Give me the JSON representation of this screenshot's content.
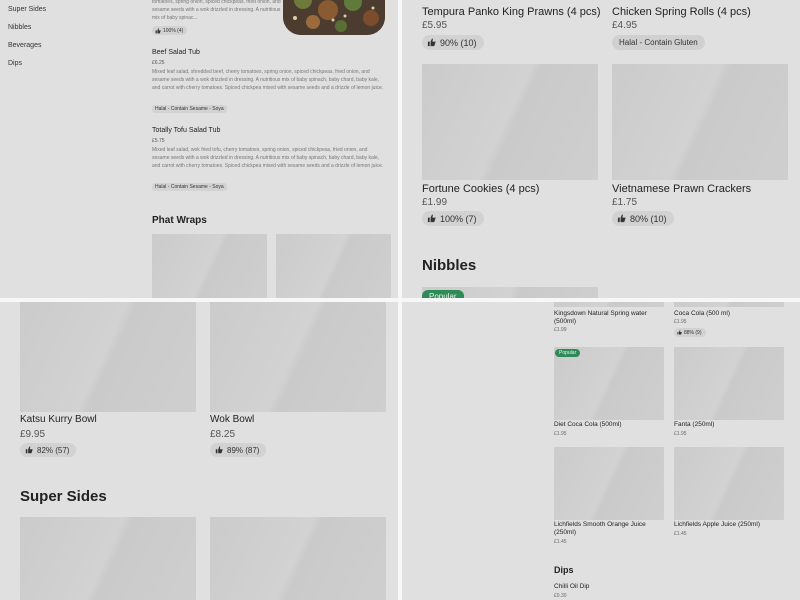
{
  "sidebar": {
    "items": [
      {
        "label": "Super Sides"
      },
      {
        "label": "Nibbles"
      },
      {
        "label": "Beverages"
      },
      {
        "label": "Dips"
      }
    ]
  },
  "q1": {
    "top_item": {
      "desc": "tomatoes, spring onion, spiced chickpeas, fried onion, and sesame seeds with a wok drizzled in dressing. A nutritious mix of baby spinac...",
      "rating": "100% (4)"
    },
    "items": [
      {
        "title": "Beef Salad Tub",
        "price": "£6.25",
        "desc": "Mixed leaf salad, shredded beef, cherry tomatoes, spring onion, spiced chickpeas, fried onion, and sesame seeds with a wok drizzled in dressing. A nutritious mix of baby spinach, baby chard, baby kale, and carrot with cherry tomatoes. Spiced chickpea mixed with sesame seeds and a drizzle of lemon juice.",
        "tag": "Halal - Contain Sesame - Soya"
      },
      {
        "title": "Totally Tofu Salad Tub",
        "price": "£5.75",
        "desc": "Mixed leaf salad, wok fried tofu, cherry tomatoes, spring onion, spiced chickpeas, fried onion, and sesame seeds with a wok drizzled in dressing. A nutritious mix of baby spinach, baby chard, baby kale, and carrot with cherry tomatoes. Spiced chickpea mixed with sesame seeds and a drizzle of lemon juice.",
        "tag": "Halal - Contain Sesame - Soya"
      }
    ],
    "section_title": "Phat Wraps"
  },
  "q2": {
    "items": [
      {
        "name": "Tempura Panko King Prawns (4 pcs)",
        "price": "£5.95",
        "rating": "90% (10)"
      },
      {
        "name": "Chicken Spring Rolls (4 pcs)",
        "price": "£4.95",
        "tag": "Halal - Contain Gluten"
      },
      {
        "name": "Fortune Cookies (4 pcs)",
        "price": "£1.99",
        "rating": "100% (7)"
      },
      {
        "name": "Vietnamese Prawn Crackers",
        "price": "£1.75",
        "rating": "80% (10)"
      }
    ],
    "section_title": "Nibbles",
    "popular_label": "Popular"
  },
  "q3": {
    "items": [
      {
        "name": "Katsu Kurry Bowl",
        "price": "£9.95",
        "rating": "82% (57)"
      },
      {
        "name": "Wok Bowl",
        "price": "£8.25",
        "rating": "89% (87)"
      }
    ],
    "section_title": "Super Sides"
  },
  "q4": {
    "top_items": [
      {
        "name": "Kingsdown Natural Spring water (500ml)",
        "price": "£1.99"
      },
      {
        "name": "Coca Cola (500 ml)",
        "price": "£1.95",
        "rating": "88% (9)"
      }
    ],
    "popular_label": "Popular",
    "items": [
      {
        "name": "Diet Coca Cola (500ml)",
        "price": "£1.95"
      },
      {
        "name": "Fanta (250ml)",
        "price": "£1.95"
      },
      {
        "name": "Lichfields Smooth Orange Juice (250ml)",
        "price": "£1.45"
      },
      {
        "name": "Lichfields Apple Juice (250ml)",
        "price": "£1.45"
      }
    ],
    "section_title": "Dips",
    "dip": {
      "name": "Chilli Oil Dip",
      "price": "£0.30"
    }
  },
  "icons": {
    "thumb": "thumbs-up-icon"
  },
  "colors": {
    "popular": "#2e8b57",
    "overlay_bg": "#e0e0e0"
  }
}
